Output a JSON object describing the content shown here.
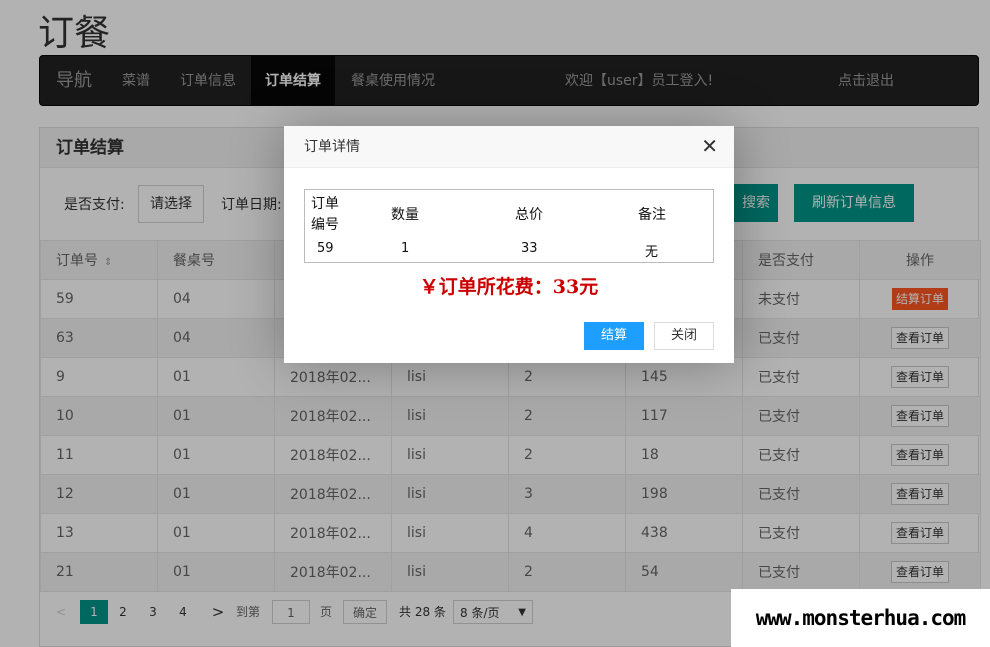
{
  "page_title": "订餐",
  "nav": {
    "brand": "导航",
    "items": [
      {
        "label": "菜谱",
        "active": false
      },
      {
        "label": "订单信息",
        "active": false
      },
      {
        "label": "订单结算",
        "active": true
      },
      {
        "label": "餐桌使用情况",
        "active": false
      }
    ],
    "welcome": "欢迎【user】员工登入!",
    "logout": "点击退出"
  },
  "panel": {
    "heading": "订单结算",
    "filter": {
      "paid_label": "是否支付:",
      "paid_select": "请选择",
      "date_label": "订单日期:",
      "search_button": "搜索",
      "refresh_button": "刷新订单信息"
    },
    "table": {
      "columns": [
        "订单号",
        "餐桌号",
        "",
        "",
        "",
        "",
        "是否支付",
        "操作"
      ],
      "rows": [
        {
          "id": "59",
          "table": "04",
          "date": "",
          "user": "",
          "qty": "",
          "total": "",
          "paid": "未支付",
          "action": "结算订单",
          "unpaid": true
        },
        {
          "id": "63",
          "table": "04",
          "date": "",
          "user": "",
          "qty": "",
          "total": "",
          "paid": "已支付",
          "action": "查看订单",
          "unpaid": false
        },
        {
          "id": "9",
          "table": "01",
          "date": "2018年02...",
          "user": "lisi",
          "qty": "2",
          "total": "145",
          "paid": "已支付",
          "action": "查看订单",
          "unpaid": false
        },
        {
          "id": "10",
          "table": "01",
          "date": "2018年02...",
          "user": "lisi",
          "qty": "2",
          "total": "117",
          "paid": "已支付",
          "action": "查看订单",
          "unpaid": false
        },
        {
          "id": "11",
          "table": "01",
          "date": "2018年02...",
          "user": "lisi",
          "qty": "2",
          "total": "18",
          "paid": "已支付",
          "action": "查看订单",
          "unpaid": false
        },
        {
          "id": "12",
          "table": "01",
          "date": "2018年02...",
          "user": "lisi",
          "qty": "3",
          "total": "198",
          "paid": "已支付",
          "action": "查看订单",
          "unpaid": false
        },
        {
          "id": "13",
          "table": "01",
          "date": "2018年02...",
          "user": "lisi",
          "qty": "4",
          "total": "438",
          "paid": "已支付",
          "action": "查看订单",
          "unpaid": false
        },
        {
          "id": "21",
          "table": "01",
          "date": "2018年02...",
          "user": "lisi",
          "qty": "2",
          "total": "54",
          "paid": "已支付",
          "action": "查看订单",
          "unpaid": false
        }
      ]
    },
    "pager": {
      "prev": "<",
      "pages": [
        "1",
        "2",
        "3",
        "4"
      ],
      "current": "1",
      "next": ">",
      "goto_label": "到第",
      "goto_value": "1",
      "page_unit": "页",
      "confirm": "确定",
      "total": "共 28 条",
      "page_size": "8 条/页"
    }
  },
  "modal": {
    "title": "订单详情",
    "headers": {
      "order_no_line1": "订单",
      "order_no_line2": "编号",
      "qty": "数量",
      "total": "总价",
      "note": "备注"
    },
    "row": {
      "order_no": "59",
      "qty": "1",
      "total": "33",
      "note": "无"
    },
    "summary": "￥订单所花费：33元",
    "ok_button": "结算",
    "close_button": "关闭"
  },
  "watermark": "www.monsterhua.com",
  "colors": {
    "teal": "#009688",
    "blue": "#1e9fff",
    "orange": "#ff5722",
    "dark": "#222222",
    "red": "#cc0000"
  }
}
